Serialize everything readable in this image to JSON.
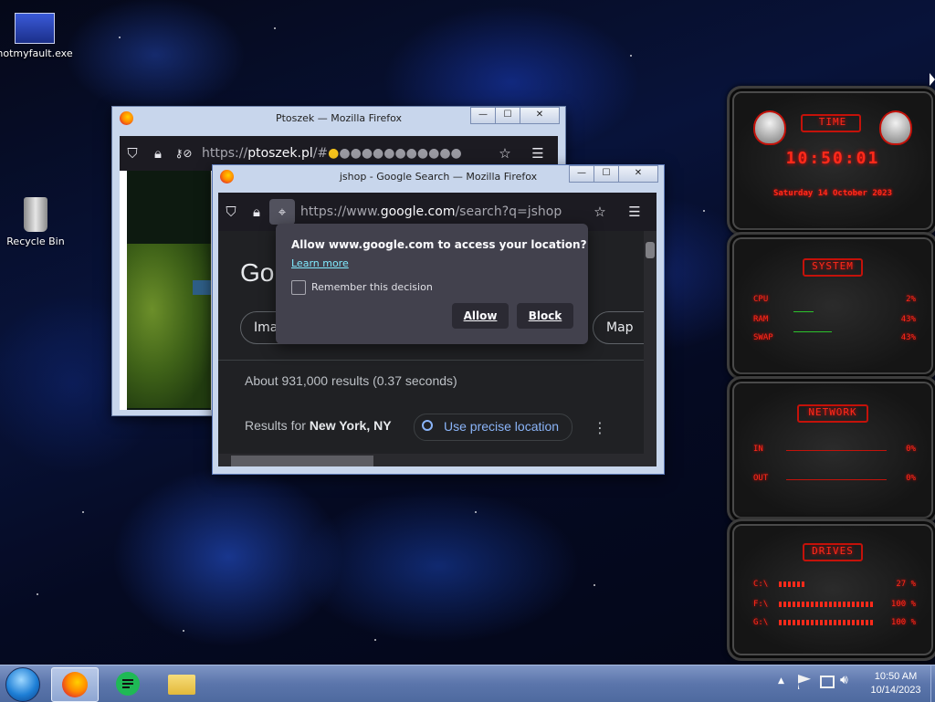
{
  "desktop": {
    "icons": [
      {
        "label": "notmyfault.exe",
        "icon": "exe-icon"
      },
      {
        "label": "Recycle Bin",
        "icon": "recycle-bin-icon"
      }
    ]
  },
  "window_back": {
    "title": "Ptoszek — Mozilla Firefox",
    "url_prefix": "https://",
    "url_host": "ptoszek.pl",
    "url_rest": "/#"
  },
  "window_front": {
    "title": "jshop - Google Search — Mozilla Firefox",
    "url_prefix": "https://www.",
    "url_host": "google.com",
    "url_rest": "/search?q=jshop",
    "page": {
      "logo_partial": "Go",
      "chip_left": "Imag",
      "chip_right": "Map",
      "result_stats": "About 931,000 results (0.37 seconds)",
      "results_for_prefix": "Results for ",
      "results_for_location": "New York, NY",
      "precise_location": "Use precise location",
      "more_icon": "⋮"
    }
  },
  "permission_popup": {
    "message": "Allow www.google.com to access your location?",
    "learn_more": "Learn more",
    "remember": "Remember this decision",
    "allow": "Allow",
    "block": "Block"
  },
  "gadget": {
    "time": {
      "title": "TIME",
      "clock": "10:50:01",
      "date": "Saturday 14 October 2023"
    },
    "system": {
      "title": "SYSTEM",
      "rows": [
        {
          "label": "CPU",
          "value": "2%"
        },
        {
          "label": "RAM",
          "value": "43%"
        },
        {
          "label": "SWAP",
          "value": "43%"
        }
      ]
    },
    "network": {
      "title": "NETWORK",
      "rows": [
        {
          "label": "IN",
          "value": "0%"
        },
        {
          "label": "OUT",
          "value": "0%"
        }
      ]
    },
    "drives": {
      "title": "DRIVES",
      "rows": [
        {
          "label": "C:\\",
          "value": "27 %"
        },
        {
          "label": "F:\\",
          "value": "100 %"
        },
        {
          "label": "G:\\",
          "value": "100 %"
        }
      ]
    }
  },
  "taskbar": {
    "apps": [
      "start-orb",
      "firefox",
      "notes-app",
      "file-explorer"
    ],
    "clock_time": "10:50 AM",
    "clock_date": "10/14/2023"
  },
  "colors": {
    "accent_red": "#ff2a1a",
    "firefox_dark": "#1c1b22",
    "google_dark": "#202124"
  }
}
